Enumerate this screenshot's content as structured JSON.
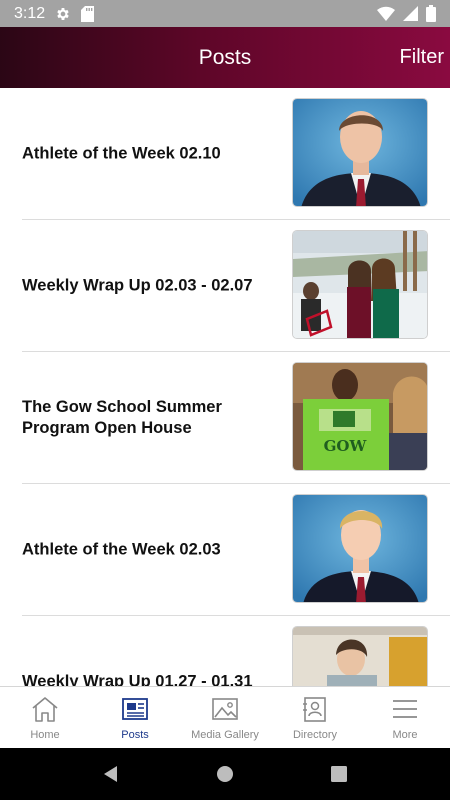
{
  "status_bar": {
    "time": "3:12",
    "left_icons": [
      "gear-icon",
      "sd-card-icon"
    ],
    "right_icons": [
      "wifi-icon",
      "signal-icon",
      "battery-icon"
    ]
  },
  "header": {
    "title": "Posts",
    "filter_label": "Filter"
  },
  "posts": [
    {
      "title": "Athlete of the Week 02.10"
    },
    {
      "title": "Weekly Wrap Up 02.03 - 02.07"
    },
    {
      "title": "The Gow School Summer Program Open House"
    },
    {
      "title": "Athlete of the Week 02.03"
    },
    {
      "title": "Weekly Wrap Up 01.27 - 01.31"
    }
  ],
  "shirt_text": "GOW",
  "bottom_nav": {
    "active": "posts",
    "items": [
      {
        "label": "Home",
        "icon": "home-icon"
      },
      {
        "label": "Posts",
        "icon": "newspaper-icon"
      },
      {
        "label": "Media Gallery",
        "icon": "image-icon"
      },
      {
        "label": "Directory",
        "icon": "contact-card-icon"
      },
      {
        "label": "More",
        "icon": "menu-icon"
      }
    ]
  },
  "colors": {
    "header_gradient_start": "#2b0615",
    "header_gradient_end": "#8a0a40",
    "active_nav": "#1e3a8c",
    "inactive_nav": "#888888"
  }
}
